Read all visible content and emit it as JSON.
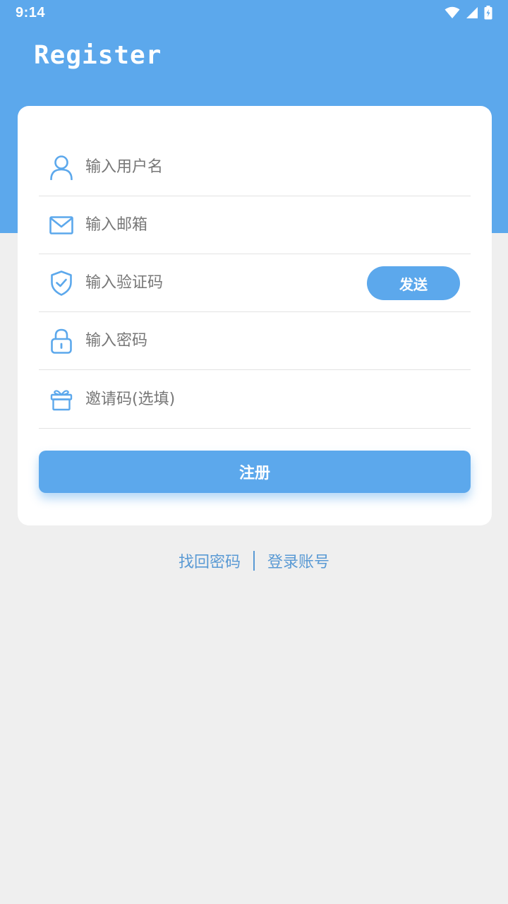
{
  "status_bar": {
    "time": "9:14"
  },
  "header": {
    "title": "Register"
  },
  "form": {
    "username": {
      "placeholder": "输入用户名",
      "value": ""
    },
    "email": {
      "placeholder": "输入邮箱",
      "value": ""
    },
    "code": {
      "placeholder": "输入验证码",
      "value": ""
    },
    "send_label": "发送",
    "password": {
      "placeholder": "输入密码",
      "value": ""
    },
    "invite": {
      "placeholder": "邀请码(选填)",
      "value": ""
    },
    "register_label": "注册"
  },
  "links": {
    "forgot_password": "找回密码",
    "login": "登录账号"
  },
  "colors": {
    "accent": "#5ca8ec",
    "link": "#5a9ad4",
    "background": "#efefef"
  },
  "icons": [
    "wifi-icon",
    "signal-icon",
    "battery-icon",
    "user-icon",
    "mail-icon",
    "shield-check-icon",
    "lock-icon",
    "gift-icon"
  ]
}
